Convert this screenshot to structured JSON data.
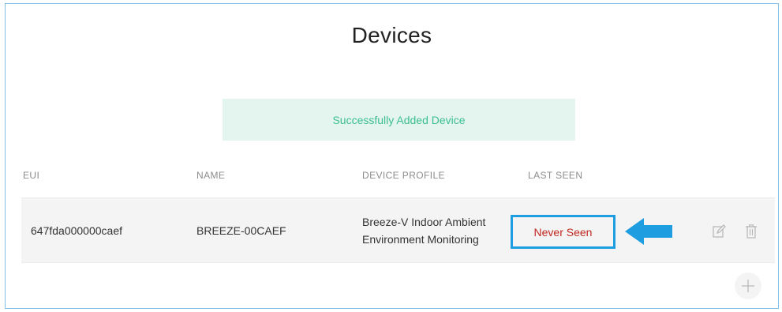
{
  "page": {
    "title": "Devices"
  },
  "alert": {
    "message": "Successfully Added Device"
  },
  "table": {
    "headers": [
      "EUI",
      "NAME",
      "DEVICE PROFILE",
      "LAST SEEN"
    ],
    "rows": [
      {
        "eui": "647fda000000caef",
        "name": "BREEZE-00CAEF",
        "profile_line1": "Breeze-V Indoor Ambient",
        "profile_line2": "Environment Monitoring",
        "last_seen": "Never Seen"
      }
    ]
  },
  "icons": {
    "edit": "edit-icon",
    "delete": "trash-icon",
    "add": "plus-icon",
    "pointer": "arrow-left-icon"
  },
  "colors": {
    "accent": "#1e9ee0",
    "success_bg": "#e4f5ef",
    "success_text": "#3bbf8f",
    "never_seen": "#c0271f"
  }
}
